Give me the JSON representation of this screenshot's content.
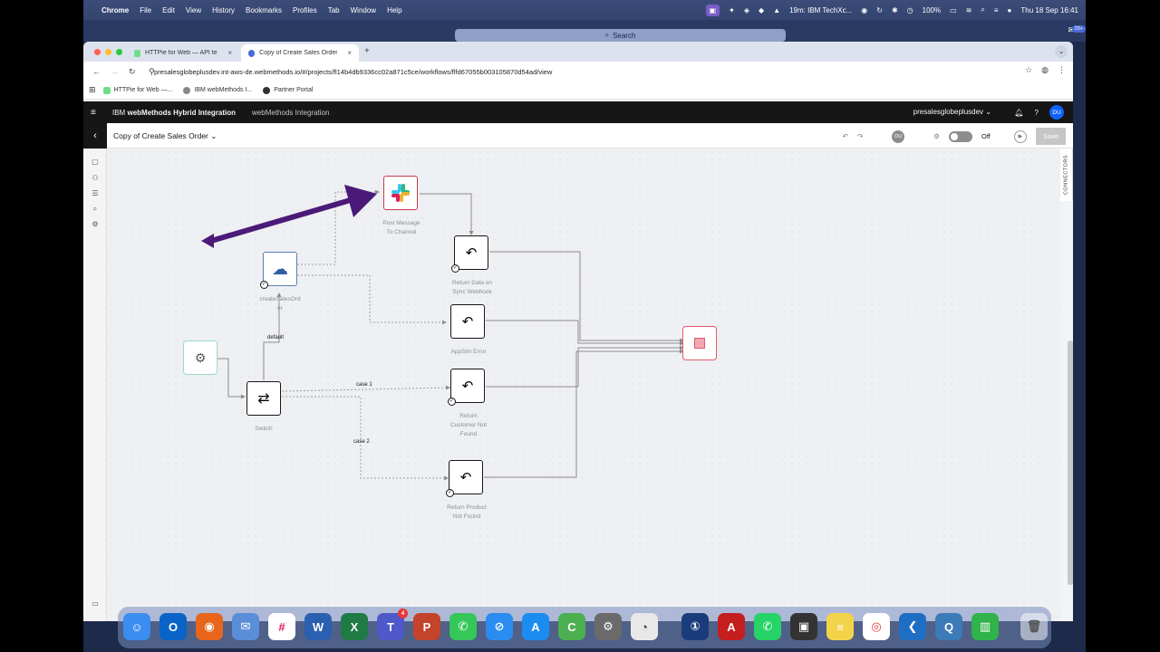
{
  "menubar": {
    "app": "Chrome",
    "items": [
      "File",
      "Edit",
      "View",
      "History",
      "Bookmarks",
      "Profiles",
      "Tab",
      "Window",
      "Help"
    ],
    "meeting": "19m: IBM TechXc...",
    "battery": "100%",
    "datetime": "Thu 18 Sep  16:41",
    "notif_count": "20+"
  },
  "spotlight": {
    "label": "Search"
  },
  "tabs": [
    {
      "label": "HTTPie for Web — API testing"
    },
    {
      "label": "Copy of Create Sales Order |"
    }
  ],
  "url": "presalesglobeplusdev.int-aws-de.webmethods.io/#/projects/fl14b4db9336cc02a871c5ce/workflows/flfd67055b003105870d54ad/view",
  "bookmarks": [
    "HTTPie for Web —...",
    "IBM webMethods I...",
    "Partner Portal"
  ],
  "header": {
    "brand_prefix": "IBM",
    "brand_bold": "webMethods Hybrid Integration",
    "product": "webMethods Integration",
    "tenant": "presalesglobeplusdev",
    "avatar": "DU"
  },
  "workflow": {
    "title": "Copy of Create Sales Order",
    "user_initials": "DU",
    "toggle_label": "Off",
    "save_label": "Save"
  },
  "side_panel": {
    "connectors_label": "CONNECTORS"
  },
  "nodes": {
    "slack": "Post Message\nTo Channel",
    "create": "createSalesOrd\ner",
    "return_sync": "Return Data on\nSync Webhook",
    "appsim": "AppSim Error",
    "switch": "Switch",
    "return_customer": "Return\nCustomer Not\nFound",
    "return_product": "Return Product\nNot Found"
  },
  "edges": {
    "default": "default",
    "case1": "case 1",
    "case2": "case 2"
  },
  "dock": {
    "teams_badge": "4"
  },
  "colors": {
    "annotation_arrow": "#4b1a78",
    "ibm_header": "#161616",
    "accent": "#0f62fe"
  }
}
